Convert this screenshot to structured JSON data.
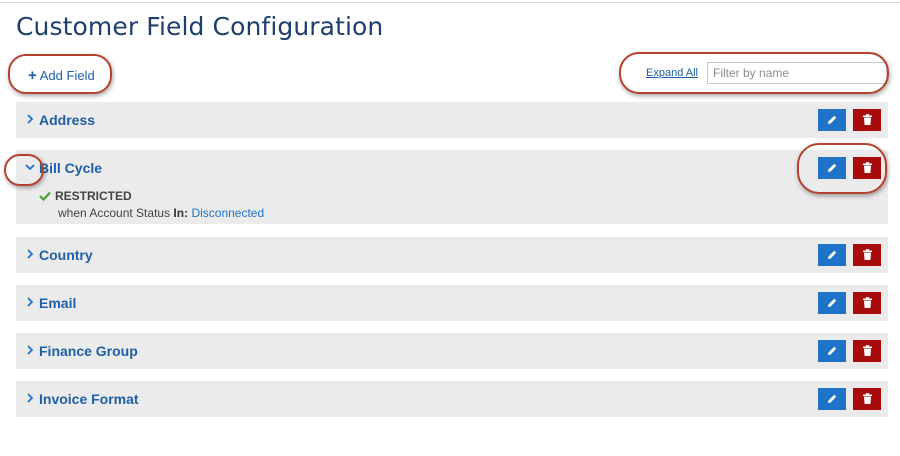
{
  "page": {
    "title": "Customer Field Configuration"
  },
  "toolbar": {
    "add_field_icon": "+",
    "add_field_label": "Add Field",
    "expand_all_label": "Expand All",
    "filter_placeholder": "Filter by name"
  },
  "fields": [
    {
      "label": "Address",
      "expanded": false
    },
    {
      "label": "Bill Cycle",
      "expanded": true,
      "details": {
        "status": "RESTRICTED",
        "condition_prefix": "when Account Status",
        "condition_operator": "In:",
        "condition_value": "Disconnected"
      }
    },
    {
      "label": "Country",
      "expanded": false
    },
    {
      "label": "Email",
      "expanded": false
    },
    {
      "label": "Finance Group",
      "expanded": false
    },
    {
      "label": "Invoice Format",
      "expanded": false
    }
  ],
  "icons": {
    "edit": "pencil-icon",
    "delete": "trash-icon",
    "collapsed": "chevron-right-icon",
    "expanded": "chevron-down-icon",
    "restricted": "check-icon"
  },
  "colors": {
    "title": "#1d3f6e",
    "link": "#1f5fa8",
    "row_background": "#ebebeb",
    "edit_button": "#1f74c9",
    "delete_button": "#a80b0b",
    "check": "#4aa32f",
    "annotation_ring": "#b5412f"
  }
}
